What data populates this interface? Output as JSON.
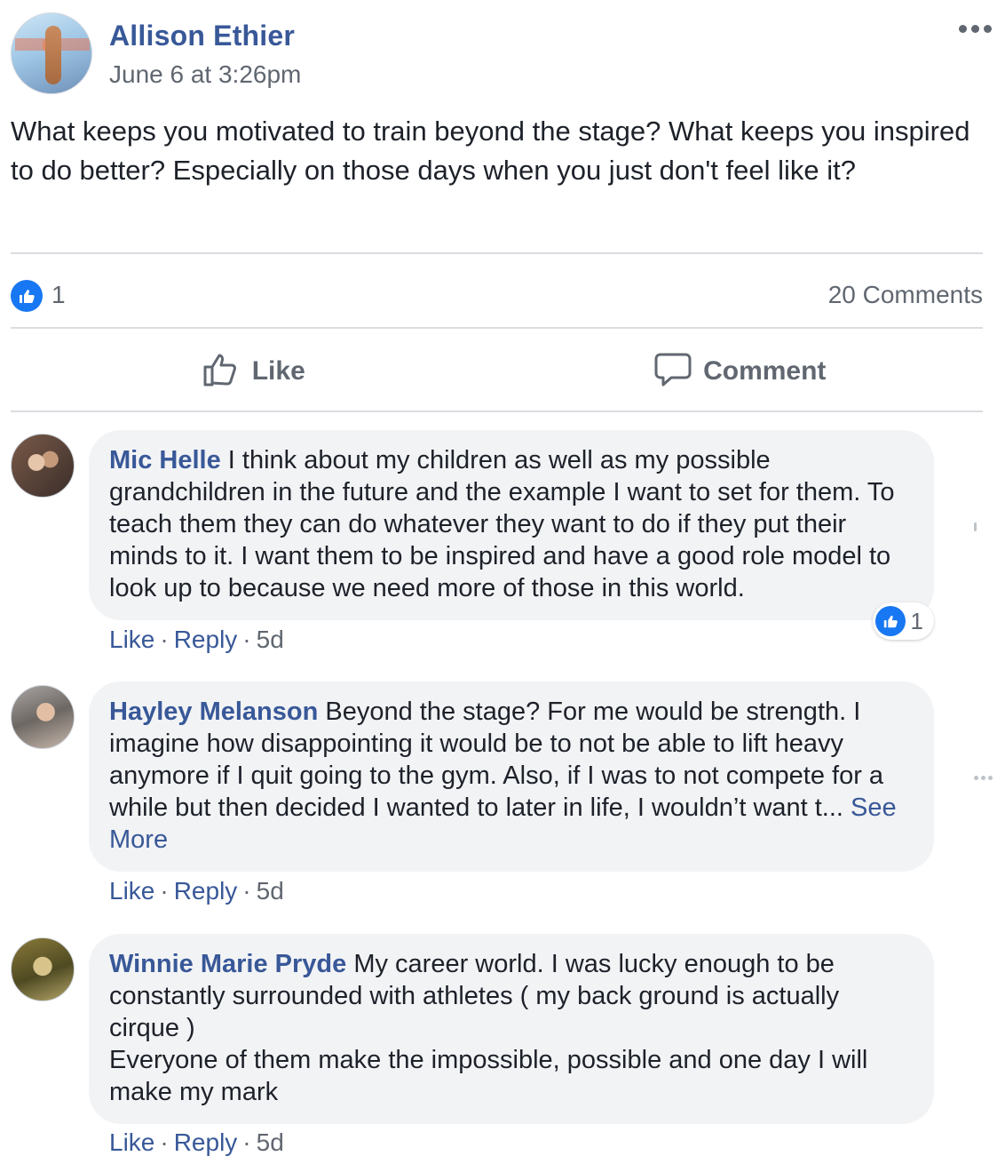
{
  "post": {
    "author": "Allison Ethier",
    "timestamp": "June 6 at 3:26pm",
    "text": "What keeps you motivated to train beyond the stage? What keeps you inspired to do better? Especially on those days when you just don't feel like it?",
    "reactions_count": "1",
    "comments_count": "20 Comments",
    "more_icon": "more-horizontal-icon"
  },
  "actions": {
    "like_label": "Like",
    "comment_label": "Comment"
  },
  "comments": [
    {
      "author": "Mic Helle",
      "text": " I think about my children as well as my possible grandchildren in the future and the example I want to set for them. To teach them they can do whatever they want to do if they put their minds to it. I want them to be inspired and have a good role model to look up to because we need more of those in this world.",
      "like_label": "Like",
      "reply_label": "Reply",
      "age": "5d",
      "reactions_count": "1"
    },
    {
      "author": "Hayley Melanson",
      "text": " Beyond the stage? For me would be strength. I imagine how disappointing it would be to not be able to lift heavy anymore if I quit going to the gym. Also, if I was to not compete for a while but then decided I wanted to later in life, I wouldn’t want t...",
      "see_more": "See More",
      "like_label": "Like",
      "reply_label": "Reply",
      "age": "5d"
    },
    {
      "author": "Winnie Marie Pryde",
      "text_line1": " My career world. I was lucky enough to be constantly surrounded with athletes ( my back ground is actually cirque )",
      "text_line2": "Everyone of them make the impossible, possible and one day I will make my mark",
      "like_label": "Like",
      "reply_label": "Reply",
      "age": "5d"
    }
  ],
  "colors": {
    "link_blue": "#385898",
    "like_blue": "#1877f2",
    "meta_gray": "#606770",
    "bubble_bg": "#f2f3f5",
    "divider": "#dadde1"
  }
}
